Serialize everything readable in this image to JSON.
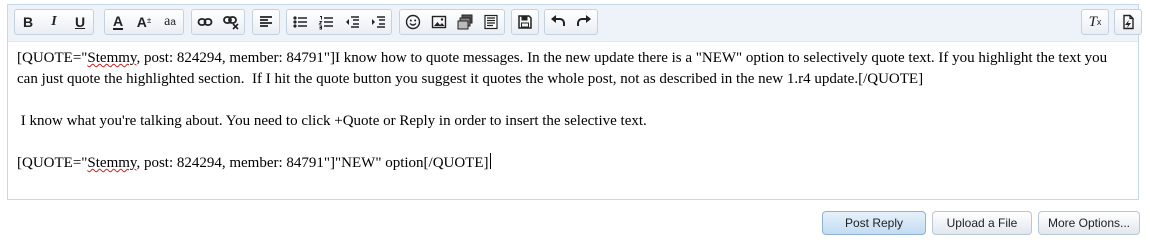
{
  "toolbar": {
    "icons": {
      "bold": "bold-icon",
      "italic": "italic-icon",
      "underline": "underline-icon",
      "text_color": "text-color-icon",
      "font_size": "font-size-icon",
      "font_family": "font-family-icon",
      "link": "link-icon",
      "unlink": "unlink-icon",
      "align": "align-left-icon",
      "bullet_list": "bullet-list-icon",
      "numbered_list": "numbered-list-icon",
      "outdent": "outdent-icon",
      "indent": "indent-icon",
      "smilies": "smiley-icon",
      "image": "image-icon",
      "media": "media-icon",
      "code": "code-icon",
      "save_draft": "save-icon",
      "undo": "undo-icon",
      "redo": "redo-icon",
      "remove_format": "remove-format-icon",
      "toggle_bbcode": "toggle-bbcode-icon"
    },
    "glyphs": {
      "bold": "B",
      "italic": "I",
      "underline": "U",
      "text_color": "A",
      "font_size": "A",
      "font_family": "a",
      "remove_format": "T"
    }
  },
  "editor": {
    "line1": "[QUOTE=\"",
    "line1_name": "Stemmy",
    "line1_rest": ", post: 824294, member: 84791\"]I know how to quote messages. In the new update there is a \"NEW\" option to selectively quote text. If you highlight the text you can just quote the highlighted section.  If I hit the quote button you suggest it quotes the whole post, not as described in the new 1.r4 update.[/QUOTE]",
    "line2": " I know what you're talking about. You need to click +Quote or Reply in order to insert the selective text.",
    "line3": "[QUOTE=\"",
    "line3_name": "Stemmy",
    "line3_rest": ", post: 824294, member: 84791\"]\"NEW\" option[/QUOTE]"
  },
  "actions": {
    "post_reply": "Post Reply",
    "upload_file": "Upload a File",
    "more_options": "More Options..."
  },
  "colors": {
    "toolbar_bg": "#eef3f9",
    "border": "#c8d8e8",
    "primary_button": "#c3dcf2",
    "spellcheck_underline": "#d02020"
  }
}
